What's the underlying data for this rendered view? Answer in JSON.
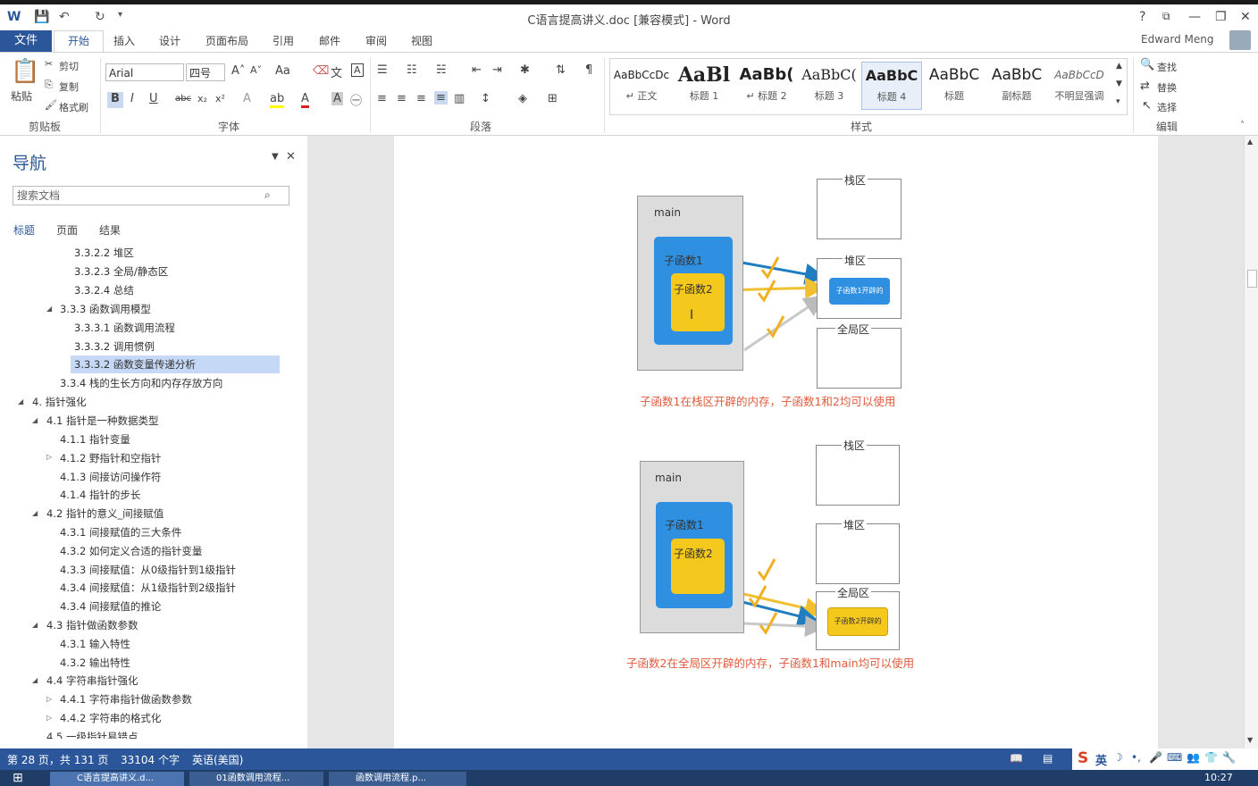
{
  "window": {
    "title": "C语言提高讲义.doc [兼容模式] - Word",
    "help": "?",
    "minimize": "—",
    "restore": "❐",
    "close": "✕"
  },
  "ribbon_tabs": [
    "文件",
    "开始",
    "插入",
    "设计",
    "页面布局",
    "引用",
    "邮件",
    "审阅",
    "视图"
  ],
  "user": "Edward Meng",
  "clipboard": {
    "paste": "粘贴",
    "cut": "剪切",
    "copy": "复制",
    "format_painter": "格式刷",
    "group": "剪贴板"
  },
  "font": {
    "name": "Arial",
    "size": "四号",
    "aa": "Aa",
    "group": "字体",
    "bold": "B",
    "italic": "I",
    "underline": "U",
    "strike": "abc",
    "sub": "x₂",
    "sup": "x²"
  },
  "paragraph": {
    "group": "段落"
  },
  "styles": {
    "group": "样式",
    "items": [
      {
        "preview": "AaBbCcDc",
        "name": "↵ 正文"
      },
      {
        "preview": "AaBl",
        "name": "标题 1"
      },
      {
        "preview": "AaBb(",
        "name": "↵ 标题 2"
      },
      {
        "preview": "AaBbC(",
        "name": "标题 3"
      },
      {
        "preview": "AaBbC",
        "name": "标题 4"
      },
      {
        "preview": "AaBbC",
        "name": "标题"
      },
      {
        "preview": "AaBbC",
        "name": "副标题"
      },
      {
        "preview": "AaBbCcD",
        "name": "不明显强调"
      }
    ]
  },
  "editing": {
    "find": "查找",
    "replace": "替换",
    "select": "选择",
    "group": "编辑"
  },
  "nav": {
    "title": "导航",
    "search_placeholder": "搜索文档",
    "tabs": [
      "标题",
      "页面",
      "结果"
    ],
    "items": [
      "3.3.2.2 堆区",
      "3.3.2.3 全局/静态区",
      "3.3.2.4 总结",
      "3.3.3 函数调用模型",
      "3.3.3.1 函数调用流程",
      "3.3.3.2 调用惯例",
      "3.3.3.2 函数变量传递分析",
      "3.3.4 栈的生长方向和内存存放方向",
      "4. 指针强化",
      "4.1 指针是一种数据类型",
      "4.1.1 指针变量",
      "4.1.2 野指针和空指针",
      "4.1.3 间接访问操作符",
      "4.1.4 指针的步长",
      "4.2 指针的意义_间接赋值",
      "4.3.1 间接赋值的三大条件",
      "4.3.2 如何定义合适的指针变量",
      "4.3.3 间接赋值：从0级指针到1级指针",
      "4.3.4 间接赋值：从1级指针到2级指针",
      "4.3.4 间接赋值的推论",
      "4.3 指针做函数参数",
      "4.3.1 输入特性",
      "4.3.2 输出特性",
      "4.4 字符串指针强化",
      "4.4.1 字符串指针做函数参数",
      "4.4.2 字符串的格式化",
      "4.5 一级指针易错点"
    ]
  },
  "diagram1": {
    "main": "main",
    "sub1": "子函数1",
    "sub2": "子函数2",
    "stack": "栈区",
    "heap": "堆区",
    "heap_block": "子函数1开辟的",
    "global": "全局区",
    "caption": "子函数1在栈区开辟的内存，子函数1和2均可以使用"
  },
  "diagram2": {
    "main": "main",
    "sub1": "子函数1",
    "sub2": "子函数2",
    "stack": "栈区",
    "heap": "堆区",
    "global": "全局区",
    "global_block": "子函数2开辟的",
    "caption": "子函数2在全局区开辟的内存，子函数1和main均可以使用"
  },
  "status": {
    "page": "第 28 页，共 131 页",
    "words": "33104 个字",
    "lang": "英语(美国)"
  },
  "ime": {
    "logo": "S",
    "mode": "英"
  },
  "taskbar": {
    "items": [
      "C语言提高讲义.d...",
      "01函数调用流程...",
      "函数调用流程.p..."
    ],
    "time": "10:27"
  },
  "colors": {
    "accent": "#2b579a",
    "sub_blue": "#2f8fe0",
    "sub_yellow": "#f5c81d",
    "caption_red": "#e05a3a"
  }
}
